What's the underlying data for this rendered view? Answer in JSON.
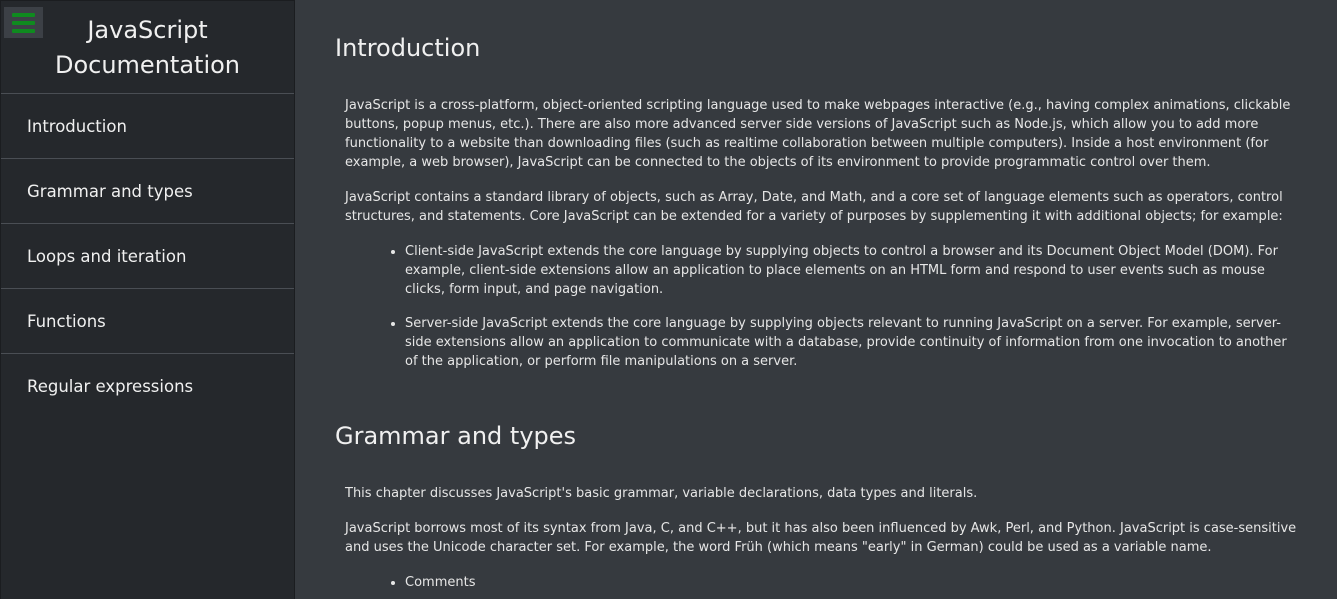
{
  "sidebar": {
    "title_line1": "JavaScript",
    "title_line2": "Documentation",
    "items": [
      {
        "label": "Introduction"
      },
      {
        "label": "Grammar and types"
      },
      {
        "label": "Loops and iteration"
      },
      {
        "label": "Functions"
      },
      {
        "label": "Regular expressions"
      }
    ]
  },
  "sections": [
    {
      "title": "Introduction",
      "paragraphs": [
        "JavaScript is a cross-platform, object-oriented scripting language used to make webpages interactive (e.g., having complex animations, clickable buttons, popup menus, etc.). There are also more advanced server side versions of JavaScript such as Node.js, which allow you to add more functionality to a website than downloading files (such as realtime collaboration between multiple computers). Inside a host environment (for example, a web browser), JavaScript can be connected to the objects of its environment to provide programmatic control over them.",
        "JavaScript contains a standard library of objects, such as Array, Date, and Math, and a core set of language elements such as operators, control structures, and statements. Core JavaScript can be extended for a variety of purposes by supplementing it with additional objects; for example:"
      ],
      "bullets": [
        "Client-side JavaScript extends the core language by supplying objects to control a browser and its Document Object Model (DOM). For example, client-side extensions allow an application to place elements on an HTML form and respond to user events such as mouse clicks, form input, and page navigation.",
        "Server-side JavaScript extends the core language by supplying objects relevant to running JavaScript on a server. For example, server-side extensions allow an application to communicate with a database, provide continuity of information from one invocation to another of the application, or perform file manipulations on a server."
      ]
    },
    {
      "title": "Grammar and types",
      "paragraphs": [
        "This chapter discusses JavaScript's basic grammar, variable declarations, data types and literals.",
        "JavaScript borrows most of its syntax from Java, C, and C++, but it has also been influenced by Awk, Perl, and Python. JavaScript is case-sensitive and uses the Unicode character set. For example, the word Früh (which means \"early\" in German) could be used as a variable name."
      ],
      "bullets": [
        "Comments"
      ]
    }
  ],
  "colors": {
    "sidebar_bg": "#25282c",
    "main_bg": "#363a3f",
    "hamburger_bars": "#0f8a1f"
  },
  "icons": {
    "menu_toggle": "hamburger-icon"
  }
}
